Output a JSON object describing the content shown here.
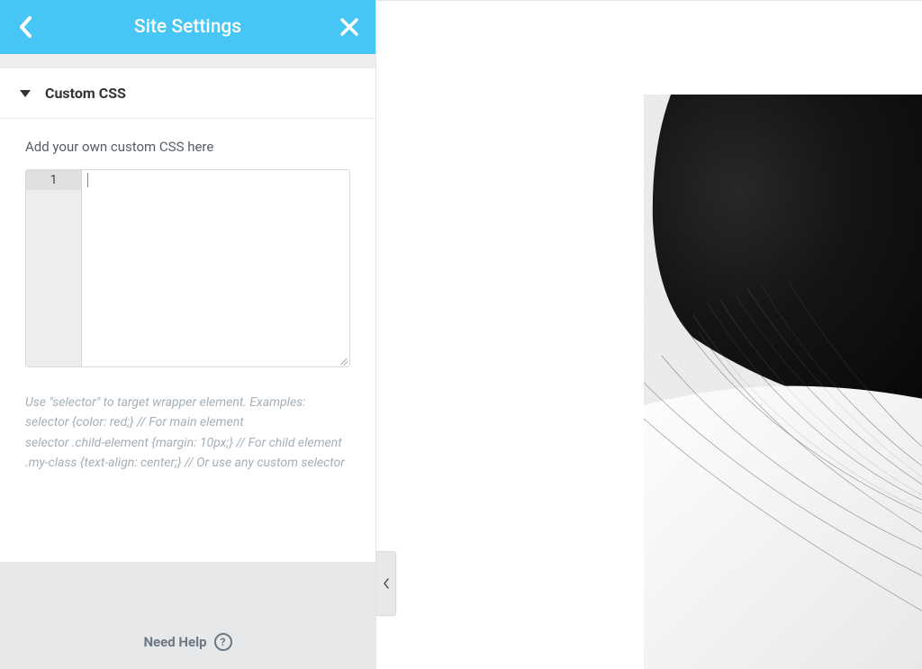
{
  "header": {
    "title": "Site Settings"
  },
  "section": {
    "label": "Custom CSS",
    "fieldLabel": "Add your own custom CSS here",
    "editor": {
      "lineNumber": "1",
      "value": ""
    },
    "hint": "Use \"selector\" to target wrapper element. Examples:\nselector {color: red;} // For main element\nselector .child-element {margin: 10px;} // For child element\n.my-class {text-align: center;} // Or use any custom selector"
  },
  "footer": {
    "helpLabel": "Need Help",
    "helpGlyph": "?"
  }
}
